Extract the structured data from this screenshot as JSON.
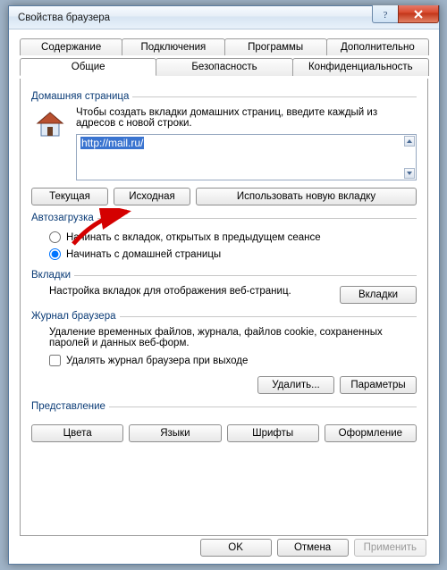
{
  "window": {
    "title": "Свойства браузера"
  },
  "tabs": {
    "top": [
      "Содержание",
      "Подключения",
      "Программы",
      "Дополнительно"
    ],
    "bottom": [
      "Общие",
      "Безопасность",
      "Конфиденциальность"
    ],
    "active": "Общие"
  },
  "homepage": {
    "legend": "Домашняя страница",
    "hint": "Чтобы создать вкладки домашних страниц, введите каждый из адресов с новой строки.",
    "url": "http://mail.ru/",
    "buttons": {
      "current": "Текущая",
      "default": "Исходная",
      "newtab": "Использовать новую вкладку"
    }
  },
  "startup": {
    "legend": "Автозагрузка",
    "opt_last": "Начинать с вкладок, открытых в предыдущем сеансе",
    "opt_home": "Начинать с домашней страницы",
    "selected": "home"
  },
  "tabs_section": {
    "legend": "Вкладки",
    "desc": "Настройка вкладок для отображения веб-страниц.",
    "button": "Вкладки"
  },
  "history": {
    "legend": "Журнал браузера",
    "desc": "Удаление временных файлов, журнала, файлов cookie, сохраненных паролей и данных веб-форм.",
    "check": "Удалять журнал браузера при выходе",
    "delete": "Удалить...",
    "settings": "Параметры"
  },
  "appearance": {
    "legend": "Представление",
    "colors": "Цвета",
    "languages": "Языки",
    "fonts": "Шрифты",
    "accessibility": "Оформление"
  },
  "footer": {
    "ok": "OK",
    "cancel": "Отмена",
    "apply": "Применить"
  }
}
